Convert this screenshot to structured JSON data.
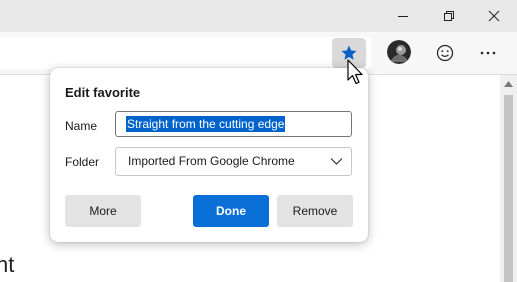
{
  "window": {
    "minimize_icon": "minimize-icon",
    "restore_icon": "restore-icon",
    "close_icon": "close-icon"
  },
  "toolbar": {
    "favorite_icon": "star-filled-icon",
    "profile_icon": "avatar",
    "feedback_icon": "smiley-icon",
    "more_icon": "more-dots-icon"
  },
  "page": {
    "partial_text": "nt"
  },
  "dialog": {
    "title": "Edit favorite",
    "name_label": "Name",
    "name_value": "Straight from the cutting edge",
    "folder_label": "Folder",
    "folder_value": "Imported From Google Chrome",
    "more_label": "More",
    "done_label": "Done",
    "remove_label": "Remove"
  },
  "colors": {
    "accent": "#0a6fd6",
    "selection": "#0063cc",
    "titlebar": "#e8e8e8",
    "toolbar": "#f7f7f7"
  }
}
